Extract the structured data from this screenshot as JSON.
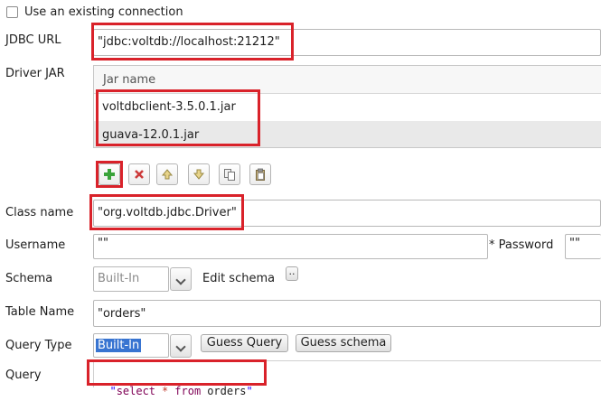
{
  "existing_connection": {
    "label": "Use an existing connection",
    "checked": false
  },
  "jdbc_url": {
    "label": "JDBC URL",
    "value": "\"jdbc:voltdb://localhost:21212\""
  },
  "driver_jar": {
    "label": "Driver JAR",
    "column_header": "Jar name",
    "rows": [
      "voltdbclient-3.5.0.1.jar",
      "guava-12.0.1.jar"
    ],
    "toolbar": [
      "add-icon",
      "remove-icon",
      "move-up-icon",
      "move-down-icon",
      "copy-icon",
      "paste-icon"
    ]
  },
  "class_name": {
    "label": "Class name",
    "value": "\"org.voltdb.jdbc.Driver\""
  },
  "username": {
    "label": "Username",
    "value": "\"\""
  },
  "password": {
    "label": "* Password",
    "value": "\"\""
  },
  "schema": {
    "label": "Schema",
    "value": "Built-In",
    "edit_label": "Edit schema",
    "ellipsis": ".."
  },
  "table_name": {
    "label": "Table Name",
    "value": "\"orders\""
  },
  "query_type": {
    "label": "Query Type",
    "value": "Built-In",
    "guess_query": "Guess Query",
    "guess_schema": "Guess schema"
  },
  "query": {
    "label": "Query",
    "open_quote": "\"",
    "kw_select": "select",
    "star": "*",
    "kw_from": "from",
    "table": "orders",
    "close_quote": "\""
  },
  "colors": {
    "highlight": "#d9222a",
    "selection": "#3874d1",
    "keyword": "#7f0055",
    "string": "#2a00ff"
  }
}
